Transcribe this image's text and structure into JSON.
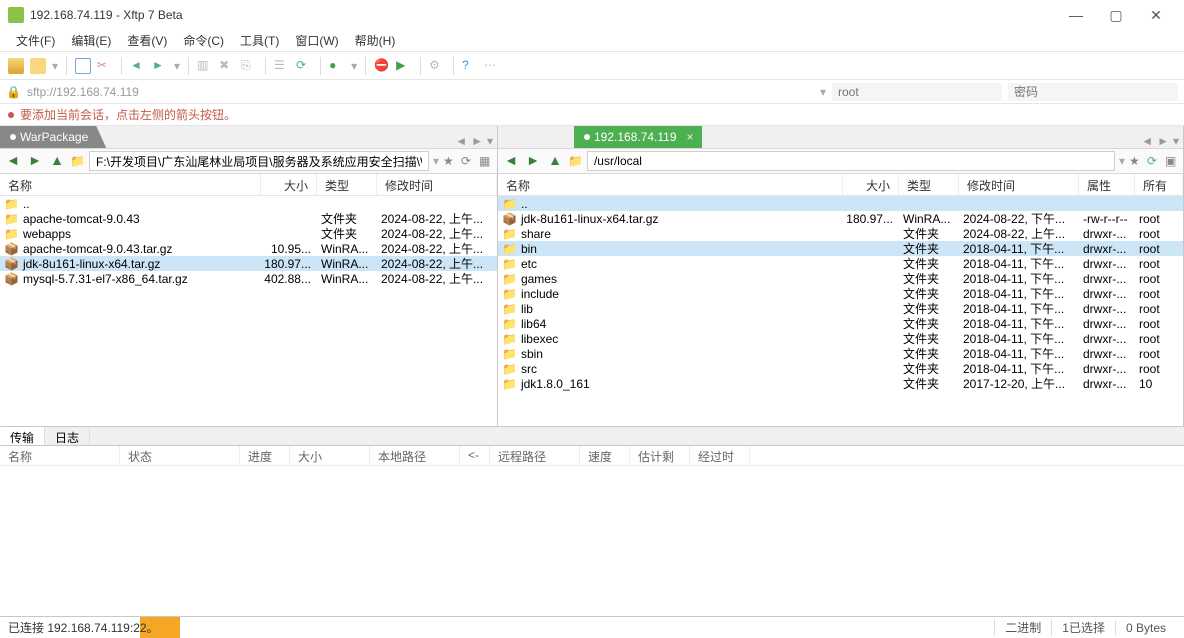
{
  "window": {
    "title": "192.168.74.119 - Xftp 7 Beta"
  },
  "menu": {
    "file": "文件(F)",
    "edit": "编辑(E)",
    "view": "查看(V)",
    "cmd": "命令(C)",
    "tool": "工具(T)",
    "window": "窗口(W)",
    "help": "帮助(H)"
  },
  "address": {
    "url": "sftp://192.168.74.119",
    "user": "root",
    "pass": "密码"
  },
  "hint": "要添加当前会话，点击左侧的箭头按钮。",
  "left": {
    "tab": "WarPackage",
    "path": "F:\\开发项目\\广东汕尾林业局项目\\服务器及系统应用安全扫描\\WarPackage",
    "cols": {
      "name": "名称",
      "size": "大小",
      "type": "类型",
      "date": "修改时间"
    },
    "rows": [
      {
        "name": "..",
        "icon": "fld",
        "size": "",
        "type": "",
        "date": ""
      },
      {
        "name": "apache-tomcat-9.0.43",
        "icon": "fld",
        "size": "",
        "type": "文件夹",
        "date": "2024-08-22, 上午..."
      },
      {
        "name": "webapps",
        "icon": "fld",
        "size": "",
        "type": "文件夹",
        "date": "2024-08-22, 上午..."
      },
      {
        "name": "apache-tomcat-9.0.43.tar.gz",
        "icon": "arc",
        "size": "10.95...",
        "type": "WinRA...",
        "date": "2024-08-22, 上午..."
      },
      {
        "name": "jdk-8u161-linux-x64.tar.gz",
        "icon": "arc",
        "size": "180.97...",
        "type": "WinRA...",
        "date": "2024-08-22, 上午...",
        "sel": true
      },
      {
        "name": "mysql-5.7.31-el7-x86_64.tar.gz",
        "icon": "arc",
        "size": "402.88...",
        "type": "WinRA...",
        "date": "2024-08-22, 上午..."
      }
    ]
  },
  "right": {
    "tab": "192.168.74.119",
    "path": "/usr/local",
    "cols": {
      "name": "名称",
      "size": "大小",
      "type": "类型",
      "date": "修改时间",
      "perm": "属性",
      "owner": "所有者"
    },
    "rows": [
      {
        "name": "..",
        "icon": "fld",
        "size": "",
        "type": "",
        "date": "",
        "perm": "",
        "owner": "",
        "sel": true
      },
      {
        "name": "jdk-8u161-linux-x64.tar.gz",
        "icon": "arc",
        "size": "180.97...",
        "type": "WinRA...",
        "date": "2024-08-22, 下午...",
        "perm": "-rw-r--r--",
        "owner": "root"
      },
      {
        "name": "share",
        "icon": "fld",
        "size": "",
        "type": "文件夹",
        "date": "2024-08-22, 上午...",
        "perm": "drwxr-...",
        "owner": "root"
      },
      {
        "name": "bin",
        "icon": "fld",
        "size": "",
        "type": "文件夹",
        "date": "2018-04-11, 下午...",
        "perm": "drwxr-...",
        "owner": "root",
        "sel": true
      },
      {
        "name": "etc",
        "icon": "fld",
        "size": "",
        "type": "文件夹",
        "date": "2018-04-11, 下午...",
        "perm": "drwxr-...",
        "owner": "root"
      },
      {
        "name": "games",
        "icon": "fld",
        "size": "",
        "type": "文件夹",
        "date": "2018-04-11, 下午...",
        "perm": "drwxr-...",
        "owner": "root"
      },
      {
        "name": "include",
        "icon": "fld",
        "size": "",
        "type": "文件夹",
        "date": "2018-04-11, 下午...",
        "perm": "drwxr-...",
        "owner": "root"
      },
      {
        "name": "lib",
        "icon": "fld",
        "size": "",
        "type": "文件夹",
        "date": "2018-04-11, 下午...",
        "perm": "drwxr-...",
        "owner": "root"
      },
      {
        "name": "lib64",
        "icon": "fld",
        "size": "",
        "type": "文件夹",
        "date": "2018-04-11, 下午...",
        "perm": "drwxr-...",
        "owner": "root"
      },
      {
        "name": "libexec",
        "icon": "fld",
        "size": "",
        "type": "文件夹",
        "date": "2018-04-11, 下午...",
        "perm": "drwxr-...",
        "owner": "root"
      },
      {
        "name": "sbin",
        "icon": "fld",
        "size": "",
        "type": "文件夹",
        "date": "2018-04-11, 下午...",
        "perm": "drwxr-...",
        "owner": "root"
      },
      {
        "name": "src",
        "icon": "fld",
        "size": "",
        "type": "文件夹",
        "date": "2018-04-11, 下午...",
        "perm": "drwxr-...",
        "owner": "root"
      },
      {
        "name": "jdk1.8.0_161",
        "icon": "fld",
        "size": "",
        "type": "文件夹",
        "date": "2017-12-20, 上午...",
        "perm": "drwxr-...",
        "owner": "10"
      }
    ]
  },
  "log": {
    "tab1": "传输",
    "tab2": "日志"
  },
  "xfer": {
    "name": "名称",
    "status": "状态",
    "progress": "进度",
    "size": "大小",
    "localpath": "本地路径",
    "arrow": "<->",
    "remotepath": "远程路径",
    "speed": "速度",
    "eta": "估计剩余...",
    "elapsed": "经过时间"
  },
  "status": {
    "conn": "已连接 192.168.74.119:22。",
    "seg1": "二进制",
    "seg2": "1已选择",
    "seg3": "0 Bytes"
  }
}
